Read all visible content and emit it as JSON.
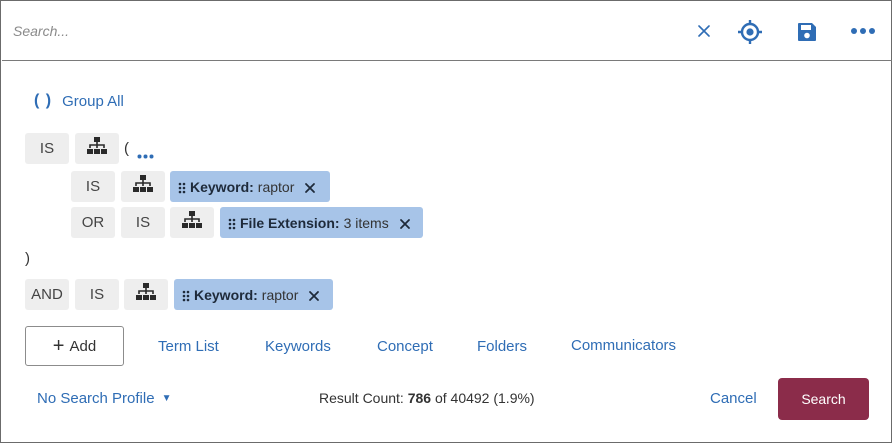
{
  "search": {
    "placeholder": "Search...",
    "value": ""
  },
  "toolbar": {
    "clear_icon": "close-icon",
    "target_icon": "crosshair-icon",
    "save_icon": "save-icon",
    "more_icon": "more-horizontal-icon"
  },
  "group_all": {
    "icon": "( )",
    "label": "Group All"
  },
  "query": {
    "open_paren": "(",
    "close_paren": ")",
    "rows": [
      {
        "operator": "IS"
      },
      {
        "operator": "IS",
        "term_label": "Keyword:",
        "term_value": "raptor"
      },
      {
        "connector": "OR",
        "operator": "IS",
        "term_label": "File Extension:",
        "term_value": "3 items"
      },
      {
        "connector": "AND",
        "operator": "IS",
        "term_label": "Keyword:",
        "term_value": "raptor"
      }
    ]
  },
  "actions": {
    "add_label": "Add",
    "tabs": [
      "Term List",
      "Keywords",
      "Concept",
      "Folders",
      "Communicators"
    ]
  },
  "footer": {
    "profile_label": "No Search Profile",
    "result_prefix": "Result Count:",
    "result_count": "786",
    "result_suffix": "of 40492 (1.9%)",
    "cancel_label": "Cancel",
    "search_label": "Search"
  },
  "colors": {
    "accent": "#2f6db5",
    "term_bg": "#a7c4e8",
    "chip_bg": "#eeeeee",
    "primary_button": "#8b2c4a"
  }
}
